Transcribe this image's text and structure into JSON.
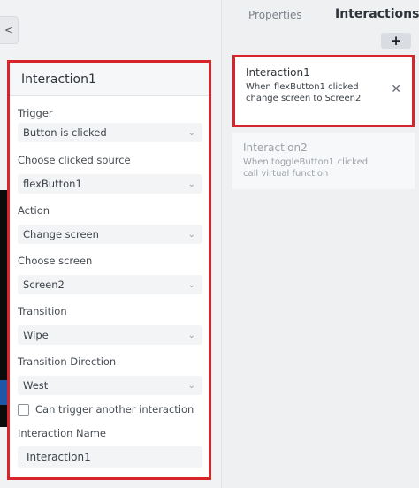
{
  "right_panel": {
    "tabs": {
      "properties": "Properties",
      "interactions": "Interactions"
    },
    "add_label": "+",
    "interactions": [
      {
        "name": "Interaction1",
        "desc_line1": "When flexButton1 clicked",
        "desc_line2": "change screen to Screen2"
      },
      {
        "name": "Interaction2",
        "desc_line1": "When toggleButton1 clicked",
        "desc_line2": "call virtual function"
      }
    ],
    "close_glyph": "✕"
  },
  "editor": {
    "title": "Interaction1",
    "trigger": {
      "label": "Trigger",
      "value": "Button is clicked"
    },
    "clicked_source": {
      "label": "Choose clicked source",
      "value": "flexButton1"
    },
    "action": {
      "label": "Action",
      "value": "Change screen"
    },
    "screen": {
      "label": "Choose screen",
      "value": "Screen2"
    },
    "transition": {
      "label": "Transition",
      "value": "Wipe"
    },
    "transition_direction": {
      "label": "Transition Direction",
      "value": "West"
    },
    "can_trigger_label": "Can trigger another interaction",
    "interaction_name": {
      "label": "Interaction Name",
      "value": "Interaction1"
    }
  },
  "collapse_glyph": "<",
  "colors": {
    "highlight": "#d8242b"
  }
}
